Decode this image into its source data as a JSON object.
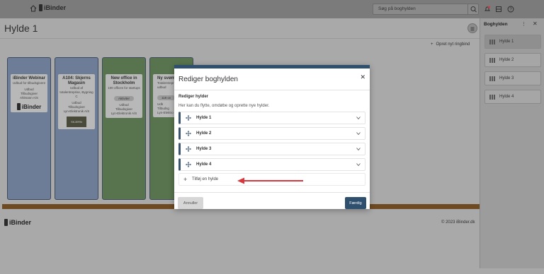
{
  "topbar": {
    "logo_text": "iBinder",
    "search_placeholder": "Søg på boghylden"
  },
  "page": {
    "title": "Hylde 1",
    "add_binding_label": "Opret nyt ringbind",
    "footer_logo": "iBinder",
    "copyright": "© 2023 iBinder.dk"
  },
  "binders": [
    {
      "title": "iBinder Webinar",
      "lines": [
        "Udbud for tilbudsgivere",
        "Udbud",
        "Tilbudsgiver",
        "Ahlmann A/S"
      ],
      "logo_text": "iBinder",
      "color": "#6d7d97"
    },
    {
      "title": "A104: Skjerns Magasin",
      "lines": [
        "Udbud af totalentreprise, Bygning C",
        "Udbud",
        "Tilbudsgiver",
        "Lyn-Elektronik A/S"
      ],
      "image_text": "SKJERN",
      "color": "#6d7d97"
    },
    {
      "title": "New office in Stockholm",
      "lines": [
        "100 offices for startups"
      ],
      "pill": "Aktiviter",
      "lines2": [
        "Udbud",
        "Tilbudsgiver",
        "Lyn-Elektronik A/S"
      ],
      "color": "#58744e"
    },
    {
      "title": "Ny svømme",
      "lines": [
        "Totalentreprise",
        "udbud"
      ],
      "pill": "118 ov",
      "lines2": [
        "Udb",
        "Tilbudsg",
        "Lyn-Elektro"
      ],
      "color": "#58744e"
    }
  ],
  "right_panel": {
    "title": "Boghylden",
    "items": [
      "Hylde 1",
      "Hylde 2",
      "Hylde 3",
      "Hylde 4"
    ]
  },
  "modal": {
    "title": "Rediger boghylden",
    "section_title": "Rediger hylder",
    "section_desc": "Her kan du flytte, omdøbe og oprette nye hylder.",
    "shelves": [
      "Hylde 1",
      "Hylde 2",
      "Hylde 3",
      "Hylde 4"
    ],
    "add_label": "Tilføj en hylde",
    "cancel_label": "Annuller",
    "done_label": "Færdig"
  },
  "colors": {
    "accent": "#2f4f6f",
    "arrow": "#d9363e",
    "shelf_wood": "#6e4a22"
  }
}
